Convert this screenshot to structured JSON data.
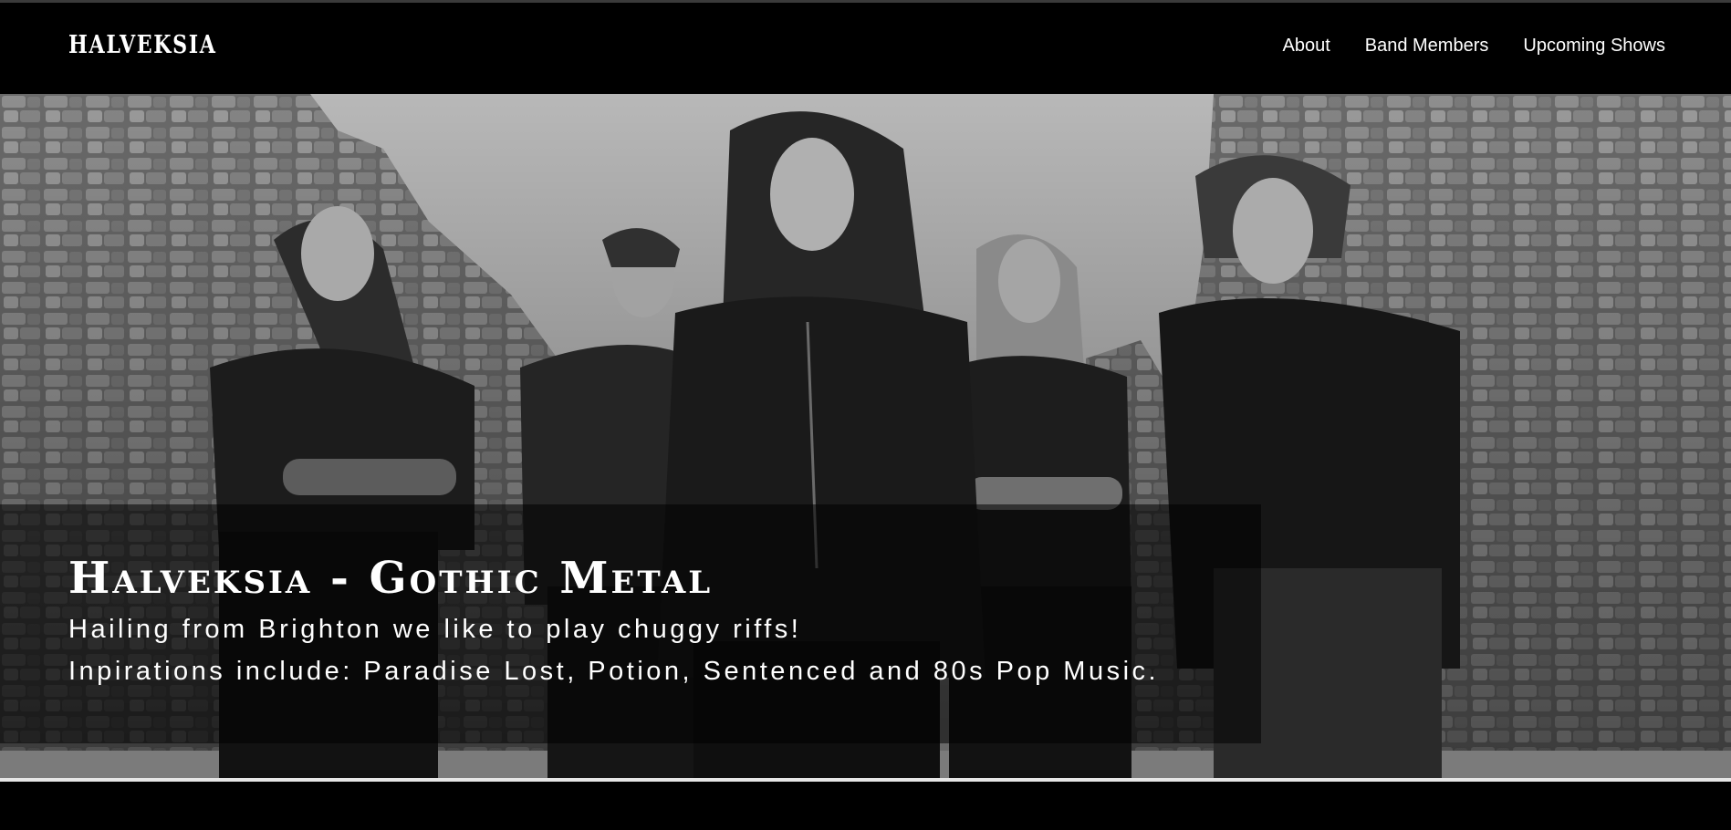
{
  "nav": {
    "brand": "HALVEKSIA",
    "links": [
      "About",
      "Band Members",
      "Upcoming Shows"
    ]
  },
  "hero": {
    "title": "Halveksia - Gothic Metal",
    "line1": "Hailing from Brighton we like to play chuggy riffs!",
    "line2": "Inpirations include: Paradise Lost, Potion, Sentenced and 80s Pop Music."
  },
  "colors": {
    "background": "#000000",
    "text": "#ffffff",
    "overlay": "rgba(0,0,0,0.55)"
  }
}
